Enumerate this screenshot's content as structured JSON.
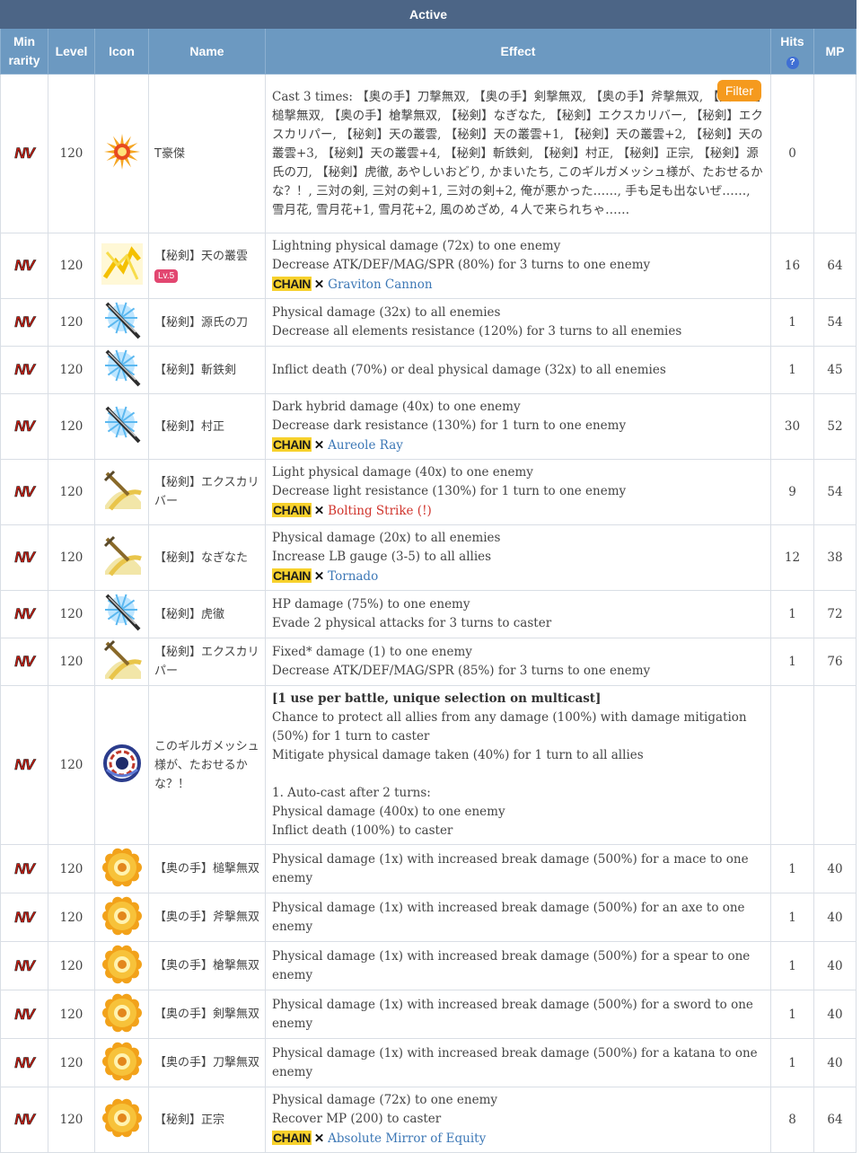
{
  "table": {
    "caption": "Active",
    "headers": {
      "min_rarity": "Min\nrarity",
      "level": "Level",
      "icon": "Icon",
      "name": "Name",
      "effect": "Effect",
      "hits": "Hits",
      "hits_help": "?",
      "mp": "MP"
    },
    "rarity_badge": "NV",
    "filter_button": "Filter",
    "chain_tag": "CHAIN",
    "chain_sep": "✕"
  },
  "rows": [
    {
      "level": "120",
      "name": "T豪傑",
      "icon": "sun-burst-icon",
      "effect": [
        "Cast 3 times: 【奥の手】刀撃無双, 【奥の手】剣撃無双, 【奥の手】斧撃無双, 【奥の手】槌撃無双, 【奥の手】槍撃無双, 【秘剣】なぎなた, 【秘剣】エクスカリバー, 【秘剣】エクスカリパー, 【秘剣】天の叢雲, 【秘剣】天の叢雲+1, 【秘剣】天の叢雲+2, 【秘剣】天の叢雲+3, 【秘剣】天の叢雲+4, 【秘剣】斬鉄剣, 【秘剣】村正, 【秘剣】正宗, 【秘剣】源氏の刀, 【秘剣】虎徹, あやしいおどり, かまいたち, このギルガメッシュ様が、たおせるかな？！, 三対の剣, 三対の剣+1, 三対の剣+2, 俺が悪かった……, 手も足も出ないぜ……, 雪月花, 雪月花+1, 雪月花+2, 風のめざめ, ４人で来られちゃ……"
      ],
      "hits": "0",
      "mp": ""
    },
    {
      "level": "120",
      "name": "【秘剣】天の叢雲",
      "badge": "Lv.5",
      "icon": "lightning-icon",
      "effect": [
        "Lightning physical damage (72x) to one enemy",
        "Decrease ATK/DEF/MAG/SPR (80%) for 3 turns to one enemy"
      ],
      "chain": "Graviton Cannon",
      "hits": "16",
      "mp": "64"
    },
    {
      "level": "120",
      "name": "【秘剣】源氏の刀",
      "icon": "katana-icon",
      "effect": [
        "Physical damage (32x) to all enemies",
        "Decrease all elements resistance (120%) for 3 turns to all enemies"
      ],
      "hits": "1",
      "mp": "54"
    },
    {
      "level": "120",
      "name": "【秘剣】斬鉄剣",
      "icon": "katana-icon",
      "effect": [
        "Inflict death (70%) or deal physical damage (32x) to all enemies"
      ],
      "hits": "1",
      "mp": "45"
    },
    {
      "level": "120",
      "name": "【秘剣】村正",
      "icon": "katana-icon",
      "effect": [
        "Dark hybrid damage (40x) to one enemy",
        "Decrease dark resistance (130%) for 1 turn to one enemy"
      ],
      "chain": "Aureole Ray",
      "hits": "30",
      "mp": "52"
    },
    {
      "level": "120",
      "name": "【秘剣】エクスカリバー",
      "icon": "sword-slash-icon",
      "effect": [
        "Light physical damage (40x) to one enemy",
        "Decrease light resistance (130%) for 1 turn to one enemy"
      ],
      "chain": "Bolting Strike (!)",
      "chain_warn": true,
      "hits": "9",
      "mp": "54"
    },
    {
      "level": "120",
      "name": "【秘剣】なぎなた",
      "icon": "sword-slash-icon",
      "effect": [
        "Physical damage (20x) to all enemies",
        "Increase LB gauge (3-5) to all allies"
      ],
      "chain": "Tornado",
      "hits": "12",
      "mp": "38"
    },
    {
      "level": "120",
      "name": "【秘剣】虎徹",
      "icon": "katana-icon",
      "effect": [
        "HP damage (75%) to one enemy",
        "Evade 2 physical attacks for 3 turns to caster"
      ],
      "hits": "1",
      "mp": "72"
    },
    {
      "level": "120",
      "name": "【秘剣】エクスカリパー",
      "icon": "sword-slash-icon",
      "effect": [
        "Fixed* damage (1) to one enemy",
        "Decrease ATK/DEF/MAG/SPR (85%) for 3 turns to one enemy"
      ],
      "hits": "1",
      "mp": "76"
    },
    {
      "level": "120",
      "name": "このギルガメッシュ様が、たおせるかな？！",
      "icon": "vortex-icon",
      "effect_bold": "[1 use per battle, unique selection on multicast]",
      "effect": [
        "Chance to protect all allies from any damage (100%) with damage mitigation (50%) for 1 turn to caster",
        "Mitigate physical damage taken (40%) for 1 turn to all allies",
        "",
        "1. Auto-cast after 2 turns:",
        "Physical damage (400x) to one enemy",
        "Inflict death (100%) to caster"
      ],
      "hits": "",
      "mp": ""
    },
    {
      "level": "120",
      "name": "【奥の手】槌撃無双",
      "icon": "gear-burst-icon",
      "effect": [
        "Physical damage (1x) with increased break damage (500%) for a mace to one enemy"
      ],
      "hits": "1",
      "mp": "40"
    },
    {
      "level": "120",
      "name": "【奥の手】斧撃無双",
      "icon": "gear-burst-icon",
      "effect": [
        "Physical damage (1x) with increased break damage (500%) for an axe to one enemy"
      ],
      "hits": "1",
      "mp": "40"
    },
    {
      "level": "120",
      "name": "【奥の手】槍撃無双",
      "icon": "gear-burst-icon",
      "effect": [
        "Physical damage (1x) with increased break damage (500%) for a spear to one enemy"
      ],
      "hits": "1",
      "mp": "40"
    },
    {
      "level": "120",
      "name": "【奥の手】剣撃無双",
      "icon": "gear-burst-icon",
      "effect": [
        "Physical damage (1x) with increased break damage (500%) for a sword to one enemy"
      ],
      "hits": "1",
      "mp": "40"
    },
    {
      "level": "120",
      "name": "【奥の手】刀撃無双",
      "icon": "gear-burst-icon",
      "effect": [
        "Physical damage (1x) with increased break damage (500%) for a katana to one enemy"
      ],
      "hits": "1",
      "mp": "40"
    },
    {
      "level": "120",
      "name": "【秘剣】正宗",
      "icon": "gear-burst-icon",
      "effect": [
        "Physical damage (72x) to one enemy",
        "Recover MP (200) to caster"
      ],
      "chain": "Absolute Mirror of Equity",
      "hits": "8",
      "mp": "64"
    }
  ]
}
